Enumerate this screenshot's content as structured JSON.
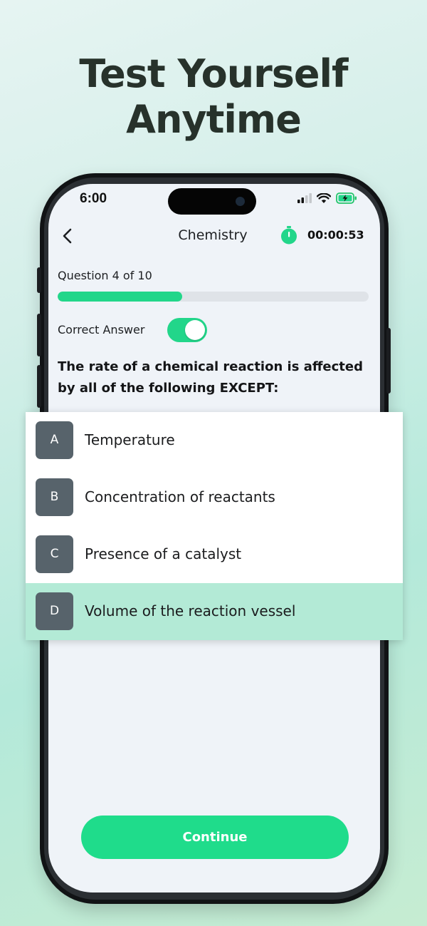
{
  "headline": {
    "line1": "Test Yourself",
    "line2": "Anytime"
  },
  "status_bar": {
    "time": "6:00",
    "icons": [
      "signal-icon",
      "wifi-icon",
      "battery-charging-icon"
    ]
  },
  "nav": {
    "back_icon": "chevron-left-icon",
    "title": "Chemistry",
    "timer_icon": "stopwatch-icon",
    "timer": "00:00:53"
  },
  "quiz": {
    "question_count": "Question 4 of 10",
    "progress": 0.4,
    "correct_answer_label": "Correct Answer",
    "correct_answer_enabled": true,
    "question": "The rate of a chemical reaction is affected by all of the following EXCEPT:",
    "options": [
      {
        "letter": "A",
        "text": "Temperature",
        "selected": false
      },
      {
        "letter": "B",
        "text": "Concentration of reactants",
        "selected": false
      },
      {
        "letter": "C",
        "text": "Presence of a catalyst",
        "selected": false
      },
      {
        "letter": "D",
        "text": "Volume of the reaction vessel",
        "selected": true
      }
    ],
    "continue_label": "Continue"
  },
  "colors": {
    "accent": "#22d68a",
    "selected_option": "#b3ead6",
    "option_letter_bg": "#57636b",
    "headline": "#27322b"
  }
}
